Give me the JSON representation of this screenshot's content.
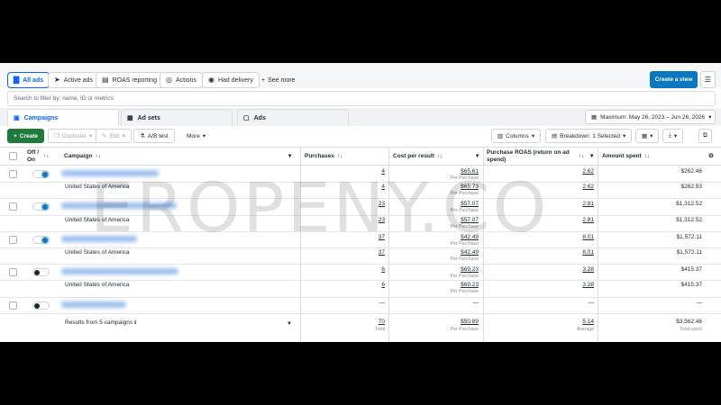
{
  "views": {
    "all_ads": "All ads",
    "active_ads": "Active ads",
    "roas_reporting": "ROAS reporting",
    "actions": "Actions",
    "had_delivery": "Had delivery",
    "see_more": "See more",
    "create_view": "Create a view"
  },
  "filter_placeholder": "Search to filter by: name, ID or metrics",
  "tabs": {
    "campaigns": "Campaigns",
    "ad_sets": "Ad sets",
    "ads": "Ads"
  },
  "date_range": "Maximum: May 26, 2023 – Jun 26, 2026",
  "toolbar": {
    "create": "Create",
    "duplicate": "Duplicate",
    "edit": "Edit",
    "ab_test": "A/B test",
    "more": "More",
    "columns": "Columns",
    "breakdown": "Breakdown: 1 Selected"
  },
  "columns": {
    "off_on": "Off / On",
    "campaign": "Campaign",
    "purchases": "Purchases",
    "cost_per_result": "Cost per result",
    "roas": "Purchase ROAS (return on ad spend)",
    "amount_spent": "Amount spent"
  },
  "sort_icon": "↑↓",
  "per_purchase": "Per Purchase",
  "rows": [
    {
      "type": "campaign",
      "on": true,
      "purchases": "4",
      "cost": "$65.61",
      "roas": "2.62",
      "spent": "$262.46"
    },
    {
      "type": "breakdown",
      "name": "United States of America",
      "purchases": "4",
      "cost": "$65.73",
      "roas": "2.62",
      "spent": "$262.93"
    },
    {
      "type": "campaign",
      "on": true,
      "purchases": "23",
      "cost": "$57.07",
      "roas": "2.81",
      "spent": "$1,312.52"
    },
    {
      "type": "breakdown",
      "name": "United States of America",
      "purchases": "23",
      "cost": "$57.07",
      "roas": "2.81",
      "spent": "$1,312.52"
    },
    {
      "type": "campaign",
      "on": true,
      "purchases": "37",
      "cost": "$42.49",
      "roas": "8.01",
      "spent": "$1,572.11"
    },
    {
      "type": "breakdown",
      "name": "United States of America",
      "purchases": "37",
      "cost": "$42.49",
      "roas": "8.01",
      "spent": "$1,572.11"
    },
    {
      "type": "campaign",
      "on": false,
      "purchases": "6",
      "cost": "$69.23",
      "roas": "3.28",
      "spent": "$415.37"
    },
    {
      "type": "breakdown",
      "name": "United States of America",
      "purchases": "6",
      "cost": "$69.23",
      "roas": "3.28",
      "spent": "$415.37"
    },
    {
      "type": "campaign",
      "on": false,
      "purchases": "—",
      "cost": "—",
      "roas": "—",
      "spent": "—"
    }
  ],
  "summary": {
    "label": "Results from 5 campaigns",
    "purchases": "70",
    "purchases_sub": "Total",
    "cost": "$50.89",
    "cost_sub": "Per Purchase",
    "roas": "5.14",
    "roas_sub": "Average",
    "spent": "$3,562.46",
    "spent_sub": "Total spent"
  },
  "watermark": "EROPENY.CO",
  "colors": {
    "accent": "#0866ff",
    "create_view": "#0a78be",
    "create": "#1e7b3c"
  }
}
